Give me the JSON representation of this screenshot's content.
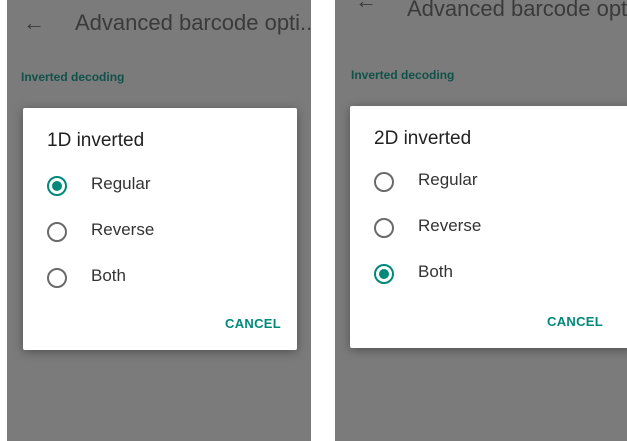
{
  "left": {
    "appbar": {
      "back_icon": "arrow-left-icon",
      "title": "Advanced barcode opti..."
    },
    "section_label": "Inverted decoding",
    "dialog": {
      "title": "1D inverted",
      "options": [
        {
          "label": "Regular",
          "selected": true
        },
        {
          "label": "Reverse",
          "selected": false
        },
        {
          "label": "Both",
          "selected": false
        }
      ],
      "cancel_label": "CANCEL"
    }
  },
  "right": {
    "appbar": {
      "back_icon": "arrow-left-icon",
      "title": "Advanced barcode opti..."
    },
    "section_label": "Inverted decoding",
    "dialog": {
      "title": "2D inverted",
      "options": [
        {
          "label": "Regular",
          "selected": false
        },
        {
          "label": "Reverse",
          "selected": false
        },
        {
          "label": "Both",
          "selected": true
        }
      ],
      "cancel_label": "CANCEL"
    }
  },
  "colors": {
    "accent": "#00897b",
    "scrim": "#7b7b7b",
    "section_text": "#10524a"
  }
}
